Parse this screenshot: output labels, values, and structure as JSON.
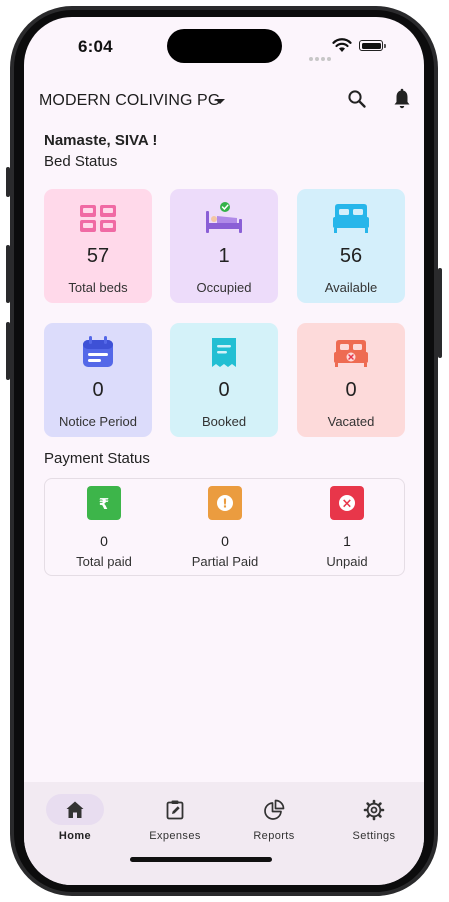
{
  "status_bar": {
    "time": "6:04"
  },
  "app_bar": {
    "title": "MODERN COLIVING PG"
  },
  "greeting": "Namaste, SIVA !",
  "bed_status": {
    "title": "Bed Status",
    "cards": [
      {
        "value": "57",
        "label": "Total beds",
        "bg": "#ffd9ea",
        "icon": "double-bed-pink-icon"
      },
      {
        "value": "1",
        "label": "Occupied",
        "bg": "#eddcfa",
        "icon": "person-sleeping-icon"
      },
      {
        "value": "56",
        "label": "Available",
        "bg": "#d4effb",
        "icon": "empty-bed-icon"
      },
      {
        "value": "0",
        "label": "Notice Period",
        "bg": "#dcdcfb",
        "icon": "calendar-icon"
      },
      {
        "value": "0",
        "label": "Booked",
        "bg": "#d4f2f9",
        "icon": "receipt-icon"
      },
      {
        "value": "0",
        "label": "Vacated",
        "bg": "#fddada",
        "icon": "bed-cancel-icon"
      }
    ]
  },
  "payment_status": {
    "title": "Payment Status",
    "items": [
      {
        "value": "0",
        "label": "Total paid",
        "color": "#3db54a",
        "icon": "rupee-icon",
        "glyph": "₹"
      },
      {
        "value": "0",
        "label": "Partial Paid",
        "color": "#eb9c3f",
        "icon": "exclamation-icon",
        "glyph": "!"
      },
      {
        "value": "1",
        "label": "Unpaid",
        "color": "#e8364a",
        "icon": "x-circle-icon",
        "glyph": "×"
      }
    ]
  },
  "nav": {
    "items": [
      {
        "label": "Home",
        "icon": "home-icon",
        "active": true
      },
      {
        "label": "Expenses",
        "icon": "expenses-icon",
        "active": false
      },
      {
        "label": "Reports",
        "icon": "pie-chart-icon",
        "active": false
      },
      {
        "label": "Settings",
        "icon": "gear-icon",
        "active": false
      }
    ]
  }
}
